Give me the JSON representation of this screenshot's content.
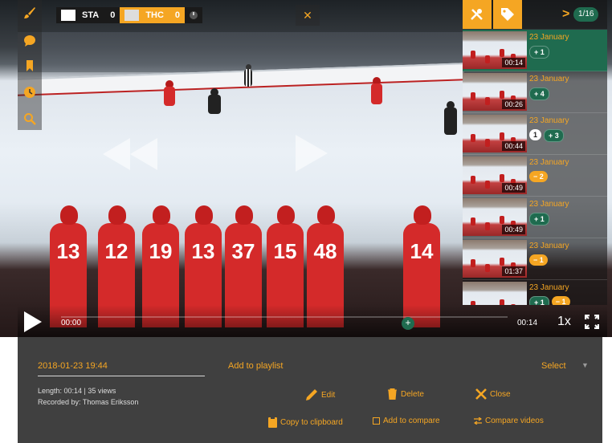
{
  "scoreboard": {
    "home": {
      "abbr": "STA",
      "score": "0"
    },
    "away": {
      "abbr": "THC",
      "score": "0"
    }
  },
  "player": {
    "time_start": "00:00",
    "time_end": "00:14",
    "speed": "1x"
  },
  "clips_panel": {
    "page": "1/16",
    "clips": [
      {
        "date": "23 January",
        "duration": "00:14",
        "tags": [
          {
            "label": "+ 1",
            "color": "green"
          }
        ],
        "active": true
      },
      {
        "date": "23 January",
        "duration": "00:26",
        "tags": [
          {
            "label": "+ 4",
            "color": "green"
          }
        ],
        "active": false
      },
      {
        "date": "23 January",
        "duration": "00:44",
        "tags": [
          {
            "label": "1",
            "color": "white"
          },
          {
            "label": "+ 3",
            "color": "green"
          }
        ],
        "active": false
      },
      {
        "date": "23 January",
        "duration": "00:49",
        "tags": [
          {
            "label": "− 2",
            "color": "orange"
          }
        ],
        "active": false
      },
      {
        "date": "23 January",
        "duration": "00:49",
        "tags": [
          {
            "label": "+ 1",
            "color": "green"
          }
        ],
        "active": false
      },
      {
        "date": "23 January",
        "duration": "01:37",
        "tags": [
          {
            "label": "− 1",
            "color": "orange"
          }
        ],
        "active": false
      },
      {
        "date": "23 January",
        "duration": "",
        "tags": [
          {
            "label": "+ 1",
            "color": "green"
          },
          {
            "label": "− 1",
            "color": "orange"
          }
        ],
        "active": false
      }
    ]
  },
  "info": {
    "date": "2018-01-23 19:44",
    "length_views": "Length: 00:14 | 35 views",
    "recorded_by": "Recorded by: Thomas Eriksson",
    "add_to_playlist": "Add to playlist",
    "select": "Select"
  },
  "actions": {
    "edit": "Edit",
    "delete": "Delete",
    "close": "Close",
    "copy": "Copy to clipboard",
    "add_compare": "Add to compare",
    "compare": "Compare videos"
  },
  "colors": {
    "accent": "#f5a623",
    "green": "#1f6b4f",
    "panel": "#404040"
  }
}
